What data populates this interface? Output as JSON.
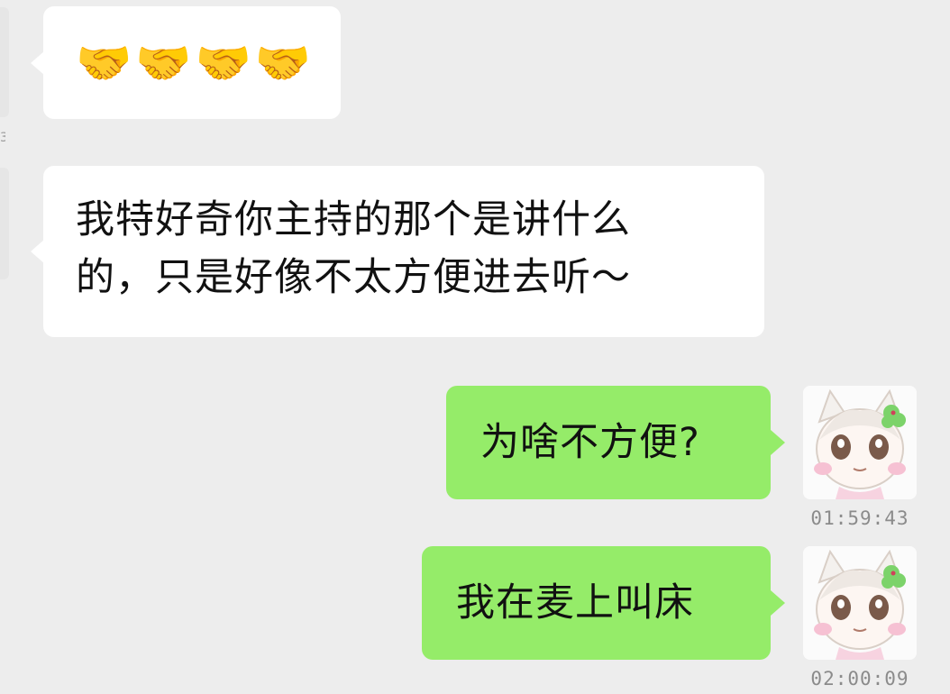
{
  "messages": [
    {
      "id": "m1",
      "direction": "incoming",
      "type": "emoji",
      "emoji_name": "handshake",
      "emoji_glyph": "🤝",
      "count": 4
    },
    {
      "id": "m2",
      "direction": "incoming",
      "type": "text",
      "lines": [
        "我特好奇你主持的那个是讲什么",
        "的，只是好像不太方便进去听～"
      ]
    },
    {
      "id": "m3",
      "direction": "outgoing",
      "type": "text",
      "text": "为啥不方便?",
      "timestamp": "01:59:43"
    },
    {
      "id": "m4",
      "direction": "outgoing",
      "type": "text",
      "text": "我在麦上叫床",
      "timestamp": "02:00:09"
    }
  ],
  "left_edge_glyph": "3",
  "colors": {
    "background": "#ededed",
    "incoming_bubble": "#ffffff",
    "outgoing_bubble": "#95ec69",
    "timestamp_text": "#8b8b8b"
  }
}
